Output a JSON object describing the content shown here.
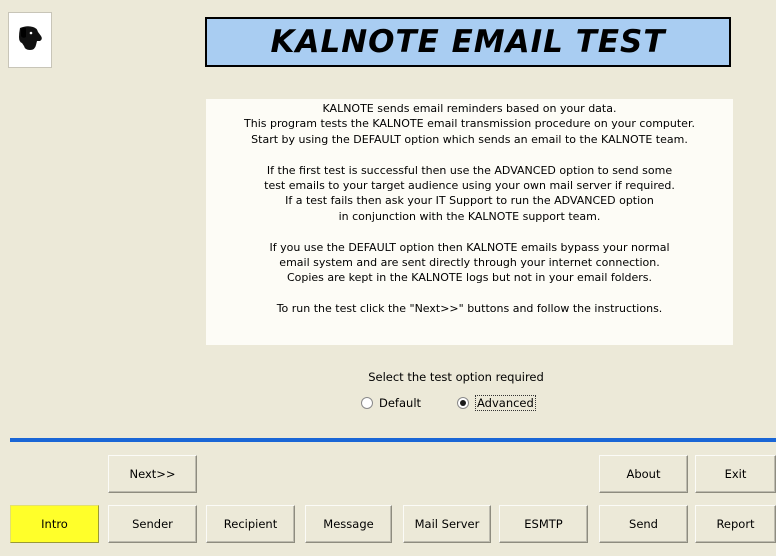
{
  "header": {
    "logo_icon": "dog-head-icon",
    "title": "KALNOTE EMAIL TEST",
    "title_bg": "#a9cdf2"
  },
  "intro": {
    "paragraphs": [
      [
        "KALNOTE sends email reminders based on your data.",
        "This program tests the KALNOTE email transmission procedure on your computer.",
        "Start by using the DEFAULT option which sends an email to the KALNOTE team."
      ],
      [
        "If the first test is successful then use the ADVANCED option to send some",
        "test emails to your target audience using your own mail server if required.",
        "If a test fails then ask your IT Support to run the ADVANCED option",
        "in conjunction with the KALNOTE support team."
      ],
      [
        "If you use the DEFAULT option then KALNOTE emails bypass your normal",
        "email system and are sent directly through your internet connection.",
        "Copies are kept in the KALNOTE logs but not in your email folders."
      ],
      [
        "To run the test click the \"Next>>\" buttons and follow the instructions."
      ]
    ]
  },
  "options": {
    "prompt": "Select the test option required",
    "items": [
      {
        "label": "Default",
        "selected": false
      },
      {
        "label": "Advanced",
        "selected": true
      }
    ]
  },
  "colors": {
    "divider": "#1a66d6",
    "active_tab": "#ffff2a"
  },
  "buttons": {
    "next": "Next>>",
    "about": "About",
    "exit": "Exit"
  },
  "tabs": [
    {
      "label": "Intro",
      "active": true
    },
    {
      "label": "Sender",
      "active": false
    },
    {
      "label": "Recipient",
      "active": false
    },
    {
      "label": "Message",
      "active": false
    },
    {
      "label": "Mail Server",
      "active": false
    },
    {
      "label": "ESMTP",
      "active": false
    },
    {
      "label": "Send",
      "active": false
    },
    {
      "label": "Report",
      "active": false
    }
  ]
}
